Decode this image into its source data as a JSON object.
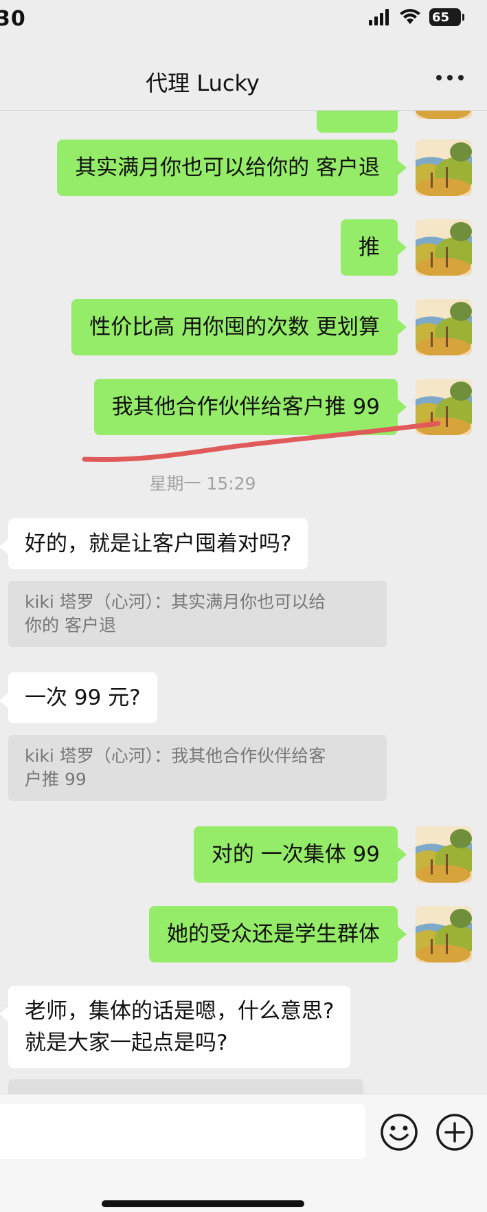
{
  "status_bar": {
    "time": "30",
    "battery": "65"
  },
  "header": {
    "title": "代理 Lucky"
  },
  "messages": {
    "m1": "其实满月你也可以给你的 客户退",
    "m2": "推",
    "m3": "性价比高 用你囤的次数 更划算",
    "m4": "我其他合作伙伴给客户推 99",
    "timestamp": "星期一 15:29",
    "r1": "好的，就是让客户囤着对吗?",
    "q1_line1": "kiki 塔罗（心河）：其实满月你也可以给",
    "q1_line2": "你的 客户退",
    "r2": "一次 99 元?",
    "q2_line1": "kiki 塔罗（心河）：我其他合作伙伴给客",
    "q2_line2": "户推 99",
    "m5": "对的 一次集体 99",
    "m6": "她的受众还是学生群体",
    "r3_line1": "老师，集体的话是嗯，什么意思?",
    "r3_line2": "就是大家一起点是吗?"
  },
  "input": {
    "value": ""
  },
  "colors": {
    "outgoing_bubble": "#95ec69",
    "incoming_bubble": "#ffffff",
    "background": "#ededed",
    "annotation_stroke": "#e05a5a"
  },
  "icons": {
    "more": "more-dots-icon",
    "emoji": "emoji-icon",
    "add": "plus-icon",
    "signal": "signal-icon",
    "wifi": "wifi-icon"
  }
}
